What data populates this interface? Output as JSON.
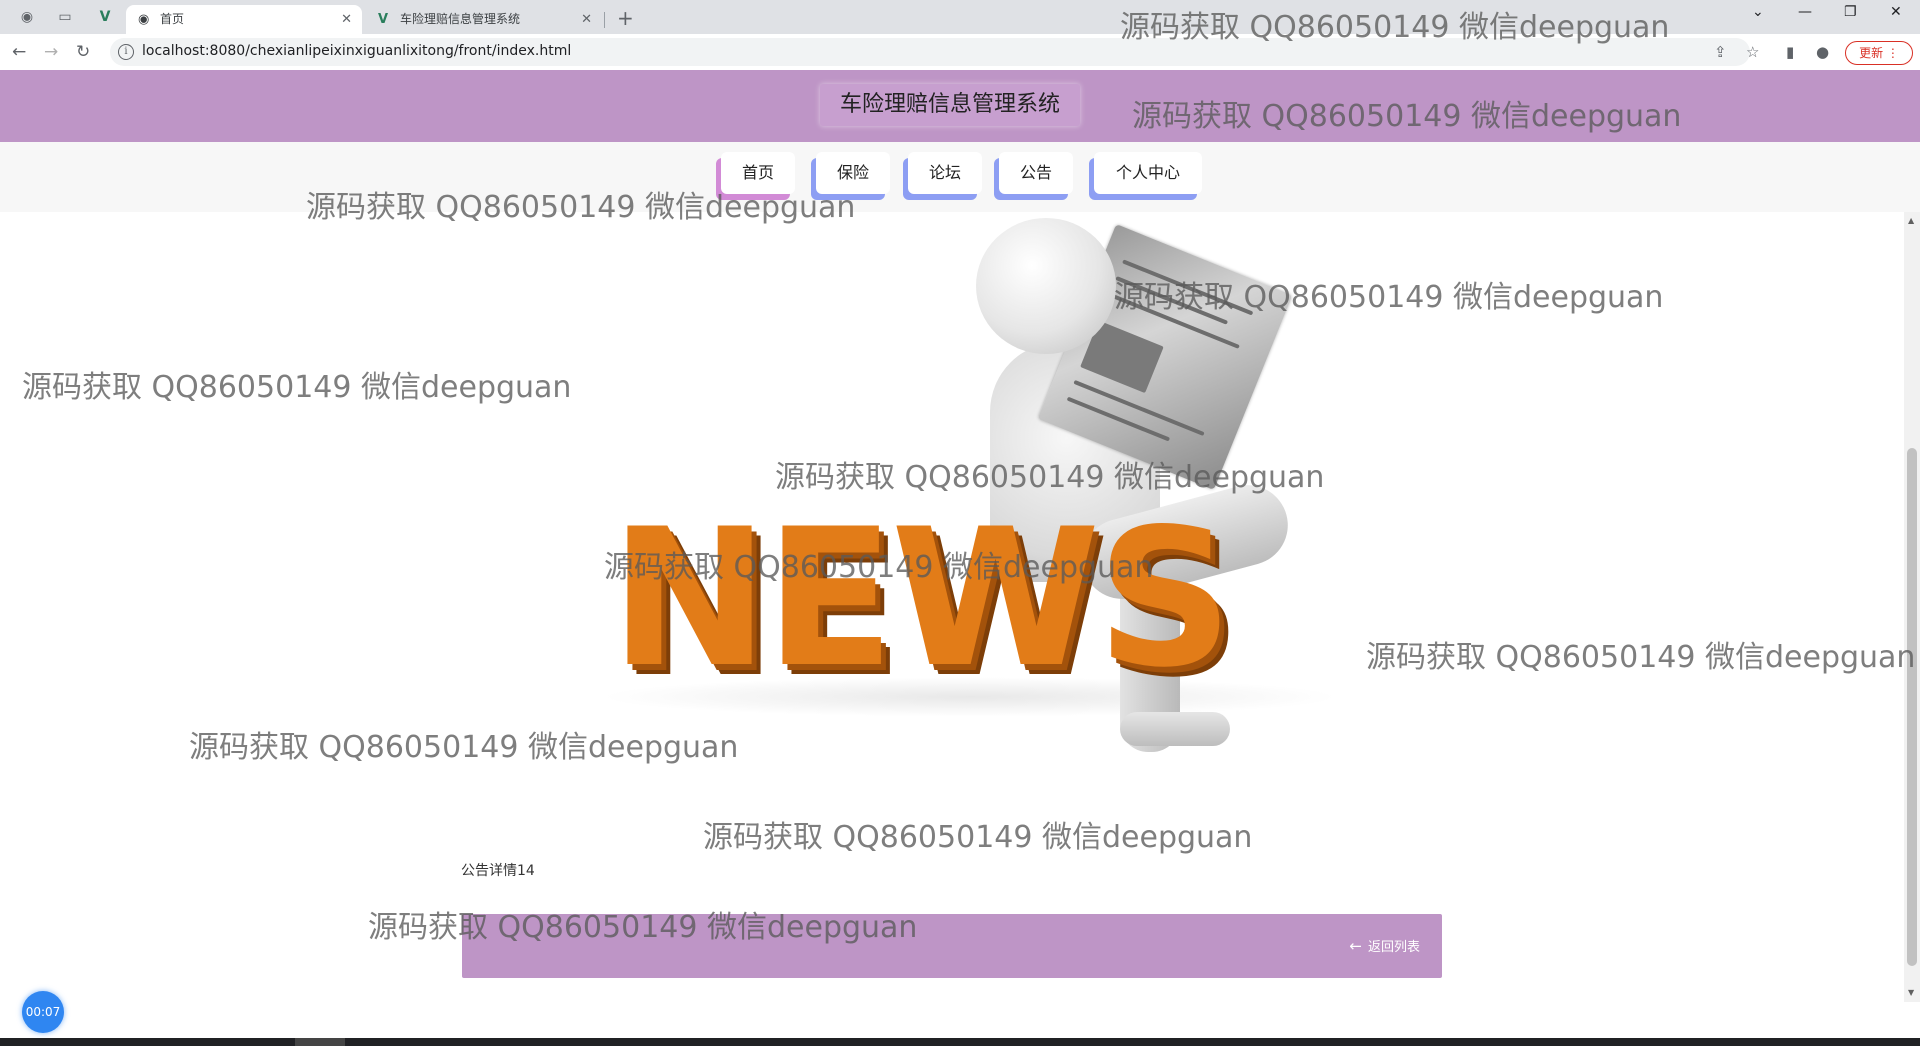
{
  "browser": {
    "tabs": [
      {
        "title": "首页",
        "active": true
      },
      {
        "title": "车险理赔信息管理系统",
        "active": false
      }
    ],
    "url": "localhost:8080/chexianlipeixinxiguanlixitong/front/index.html",
    "update_label": "更新"
  },
  "site": {
    "title": "车险理赔信息管理系统"
  },
  "nav": [
    {
      "label": "首页"
    },
    {
      "label": "保险"
    },
    {
      "label": "论坛"
    },
    {
      "label": "公告"
    },
    {
      "label": "个人中心"
    }
  ],
  "hero": {
    "word": "NEWS"
  },
  "detail": {
    "title": "公告详情14",
    "back_label": "返回列表"
  },
  "timer": "00:07",
  "watermark": "源码获取 QQ86050149 微信deepguan",
  "colors": {
    "header": "#be95c6",
    "nav_shadow_pink": "#d28bd6",
    "nav_shadow_blue": "#8d9ef3",
    "news_orange": "#e27c18",
    "timer_blue": "#2f86f1"
  }
}
